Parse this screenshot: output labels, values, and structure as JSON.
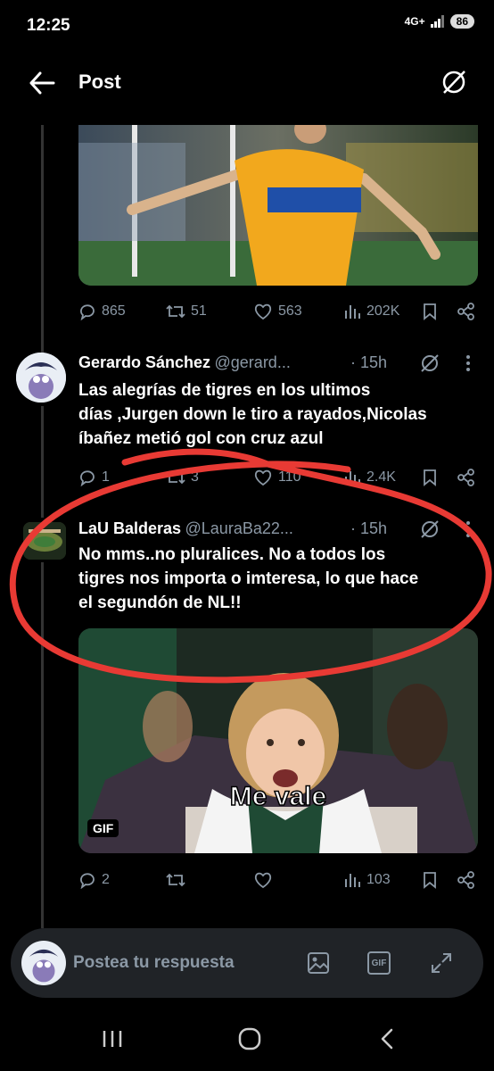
{
  "status_bar": {
    "time": "12:25",
    "network": "4G+",
    "battery": "86"
  },
  "header": {
    "title": "Post"
  },
  "tweet1": {
    "replies": "865",
    "retweets": "51",
    "likes": "563",
    "views": "202K"
  },
  "tweet2": {
    "name": "Gerardo Sánchez",
    "handle": "@gerard...",
    "time": "· 15h",
    "text_line1": "Las alegrías de tigres  en los ultimos",
    "text_line2": "días ,Jurgen down le tiro a rayados,Nicolas",
    "text_line3": "íbañez metió gol con cruz azul",
    "replies": "1",
    "retweets": "3",
    "likes": "110",
    "views": "2.4K"
  },
  "tweet3": {
    "name": "LaU Balderas",
    "handle": "@LauraBa22...",
    "time": "· 15h",
    "text_line1": "No mms..no pluralices.  No a todos los",
    "text_line2": "tigres  nos importa o imteresa, lo que hace",
    "text_line3": "el segundón de NL!!",
    "gif_caption": "Me vale",
    "gif_badge": "GIF",
    "replies": "2",
    "likes": "",
    "views": "103"
  },
  "reply_bar": {
    "placeholder": "Postea tu respuesta",
    "gif_label": "GIF"
  },
  "colors": {
    "background": "#000000",
    "muted": "#8b98a5",
    "annotation": "#e83a34"
  }
}
